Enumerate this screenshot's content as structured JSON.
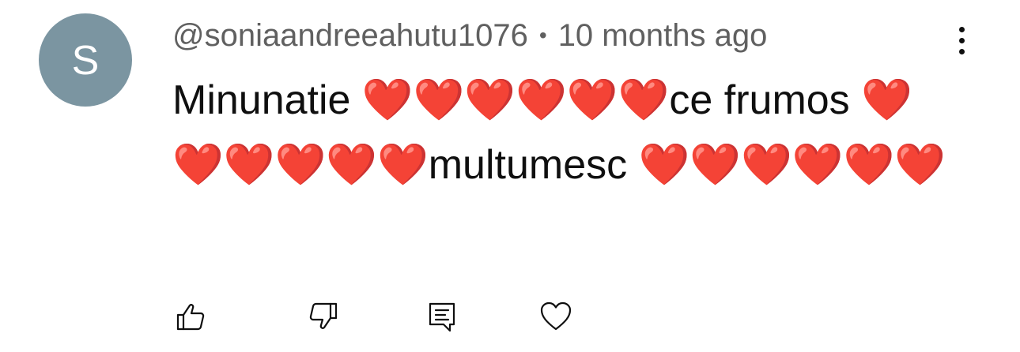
{
  "avatar": {
    "letter": "S",
    "color": "#7b95a1"
  },
  "comment": {
    "author": "@soniaandreeahutu1076",
    "separator": "•",
    "time": "10 months ago",
    "text": "Minunatie ❤️❤️❤️❤️❤️❤️ce frumos ❤️❤️❤️❤️❤️❤️multumesc ❤️❤️❤️❤️❤️❤️"
  },
  "icons": {
    "menu": "more-vertical-icon",
    "like": "thumbs-up-icon",
    "dislike": "thumbs-down-icon",
    "reply": "reply-comment-icon",
    "heart": "heart-icon"
  }
}
